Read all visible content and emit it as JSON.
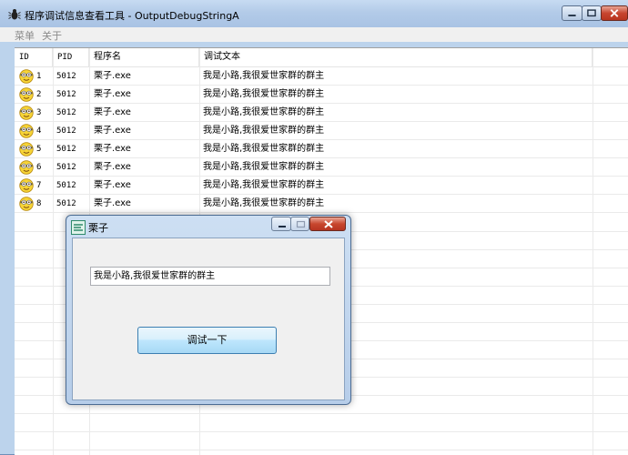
{
  "window": {
    "title": "程序调试信息查看工具 - OutputDebugStringA"
  },
  "menu": [
    {
      "label": "菜单"
    },
    {
      "label": "关于"
    }
  ],
  "table": {
    "columns": [
      "ID",
      "PID",
      "程序名",
      "调试文本",
      ""
    ],
    "rows": [
      {
        "id": "1",
        "pid": "5012",
        "name": "栗子.exe",
        "text": "我是小路,我很爱世家群的群主"
      },
      {
        "id": "2",
        "pid": "5012",
        "name": "栗子.exe",
        "text": "我是小路,我很爱世家群的群主"
      },
      {
        "id": "3",
        "pid": "5012",
        "name": "栗子.exe",
        "text": "我是小路,我很爱世家群的群主"
      },
      {
        "id": "4",
        "pid": "5012",
        "name": "栗子.exe",
        "text": "我是小路,我很爱世家群的群主"
      },
      {
        "id": "5",
        "pid": "5012",
        "name": "栗子.exe",
        "text": "我是小路,我很爱世家群的群主"
      },
      {
        "id": "6",
        "pid": "5012",
        "name": "栗子.exe",
        "text": "我是小路,我很爱世家群的群主"
      },
      {
        "id": "7",
        "pid": "5012",
        "name": "栗子.exe",
        "text": "我是小路,我很爱世家群的群主"
      },
      {
        "id": "8",
        "pid": "5012",
        "name": "栗子.exe",
        "text": "我是小路,我很爱世家群的群主"
      }
    ]
  },
  "dialog": {
    "title": "栗子",
    "input_value": "我是小路,我很爱世家群的群主",
    "button_label": "调试一下"
  },
  "icons": {
    "app": "bug-icon",
    "row": "smiley-minion-icon",
    "dialog": "app-icon"
  }
}
